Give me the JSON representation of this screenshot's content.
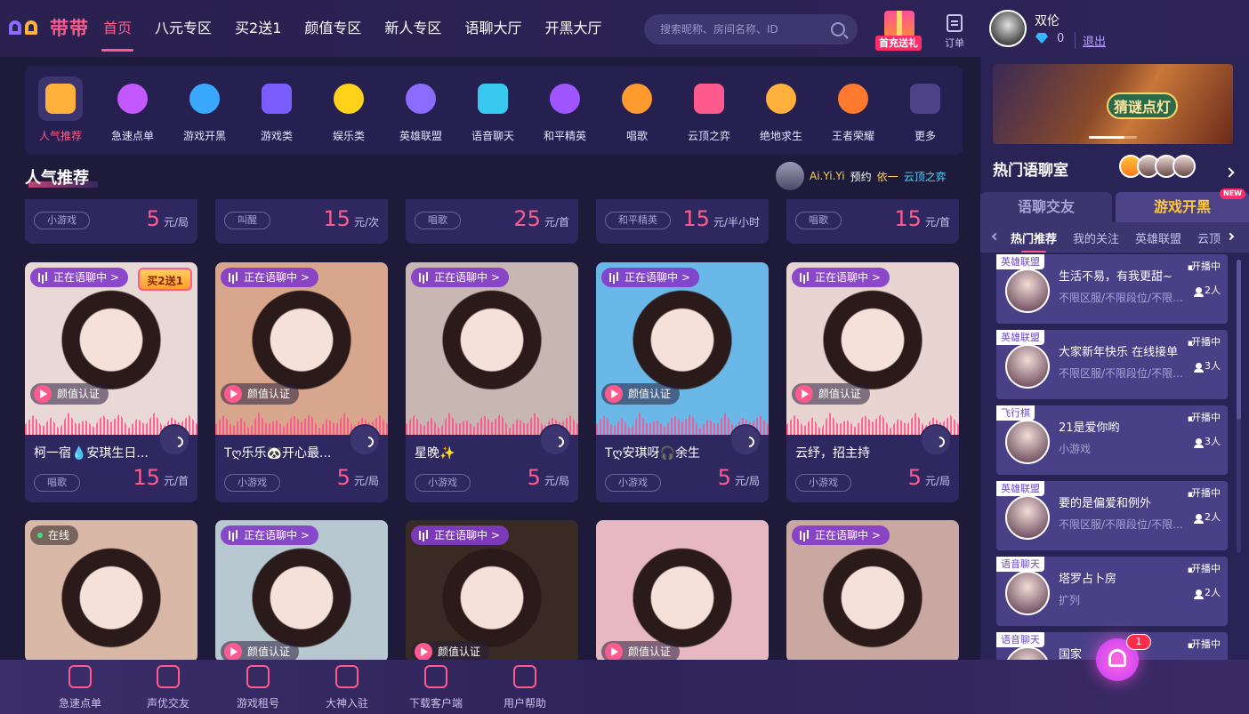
{
  "brand": {
    "name": "带带"
  },
  "nav": {
    "items": [
      {
        "label": "首页",
        "active": true
      },
      {
        "label": "八元专区"
      },
      {
        "label": "买2送1"
      },
      {
        "label": "颜值专区"
      },
      {
        "label": "新人专区"
      },
      {
        "label": "语聊大厅"
      },
      {
        "label": "开黑大厅"
      }
    ]
  },
  "search": {
    "placeholder": "搜索昵称、房间名称、ID"
  },
  "gift": {
    "label": "首充送礼"
  },
  "order": {
    "label": "订单"
  },
  "user": {
    "name": "双伦",
    "diamonds": "0",
    "logout": "退出"
  },
  "categories": [
    {
      "label": "人气推荐",
      "icon": "hexagon-star-icon",
      "color": "#ffb13b",
      "active": true
    },
    {
      "label": "急速点单",
      "icon": "checkbox-icon",
      "color": "#c458ff"
    },
    {
      "label": "游戏开黑",
      "icon": "swords-icon",
      "color": "#3aa8ff"
    },
    {
      "label": "游戏类",
      "icon": "gamepad-icon",
      "color": "#7a5cff"
    },
    {
      "label": "娱乐类",
      "icon": "chick-icon",
      "color": "#ffd21a"
    },
    {
      "label": "英雄联盟",
      "icon": "lol-icon",
      "color": "#8b6cff"
    },
    {
      "label": "语音聊天",
      "icon": "voice-bubble-icon",
      "color": "#38c9f0"
    },
    {
      "label": "和平精英",
      "icon": "pubg-mobile-icon",
      "color": "#a056ff"
    },
    {
      "label": "唱歌",
      "icon": "music-note-icon",
      "color": "#ff9a2e"
    },
    {
      "label": "云顶之弈",
      "icon": "tft-icon",
      "color": "#ff5a8e"
    },
    {
      "label": "绝地求生",
      "icon": "pubg-icon",
      "color": "#ffb13b"
    },
    {
      "label": "王者荣耀",
      "icon": "honor-of-kings-icon",
      "color": "#ff7a2e"
    },
    {
      "label": "更多",
      "icon": "more-dots-icon",
      "color": "#4d4288"
    }
  ],
  "section": {
    "title": "人气推荐"
  },
  "booking": {
    "user": "Ai.Yi.Yi",
    "verb": "预约",
    "target": "依一",
    "game": "云顶之弈"
  },
  "price_strip": [
    {
      "tag": "小游戏",
      "price": "5",
      "unit": "元/局"
    },
    {
      "tag": "叫醒",
      "price": "15",
      "unit": "元/次"
    },
    {
      "tag": "唱歌",
      "price": "25",
      "unit": "元/首"
    },
    {
      "tag": "和平精英",
      "price": "15",
      "unit": "元/半小时"
    },
    {
      "tag": "唱歌",
      "price": "15",
      "unit": "元/首"
    }
  ],
  "cards": [
    {
      "badge": "正在语聊中 >",
      "promo": "买2送1",
      "verify": "颜值认证",
      "name": "柯一宿💧安琪生日...",
      "tag": "唱歌",
      "price": "15",
      "unit": "元/首",
      "bg": "#e8d8d6"
    },
    {
      "badge": "正在语聊中 >",
      "verify": "颜值认证",
      "name": "Tღ乐乐🐼开心最...",
      "tag": "小游戏",
      "price": "5",
      "unit": "元/局",
      "bg": "#d7a68c"
    },
    {
      "badge": "正在语聊中 >",
      "name": "星晚✨",
      "tag": "小游戏",
      "price": "5",
      "unit": "元/局",
      "bg": "#c8b6b2"
    },
    {
      "badge": "正在语聊中 >",
      "verify": "颜值认证",
      "name": "Tღ安琪呀🎧余生",
      "tag": "小游戏",
      "price": "5",
      "unit": "元/局",
      "bg": "#6ab8e8"
    },
    {
      "badge": "正在语聊中 >",
      "verify": "颜值认证",
      "name": "云纾，招主持",
      "tag": "小游戏",
      "price": "5",
      "unit": "元/局",
      "bg": "#e8d4d0"
    }
  ],
  "cards_row2": [
    {
      "online": "在线",
      "bg": "#d9b8a8"
    },
    {
      "badge": "正在语聊中 >",
      "verify": "颜值认证",
      "bg": "#b8c8d0"
    },
    {
      "badge": "正在语聊中 >",
      "verify": "颜值认证",
      "bg": "#3a2a24"
    },
    {
      "verify": "颜值认证",
      "bg": "#e8b8c0"
    },
    {
      "badge": "正在语聊中 >",
      "bg": "#c8a8a0"
    }
  ],
  "sidebar": {
    "banner_text": "猜谜点灯",
    "hot_title": "热门语聊室",
    "tabs": [
      {
        "label": "语聊交友"
      },
      {
        "label": "游戏开黑",
        "new": "NEW"
      }
    ],
    "subtabs": [
      {
        "label": "热门推荐",
        "active": true
      },
      {
        "label": "我的关注"
      },
      {
        "label": "英雄联盟"
      },
      {
        "label": "云顶"
      }
    ],
    "rooms": [
      {
        "cat": "英雄联盟",
        "title": "生活不易，有我更甜~",
        "sub": "不限区服/不限段位/不限...",
        "status": "开播中",
        "count": "2人"
      },
      {
        "cat": "英雄联盟",
        "title": "大家新年快乐 在线接单",
        "sub": "不限区服/不限段位/不限...",
        "status": "开播中",
        "count": "3人"
      },
      {
        "cat": "飞行棋",
        "title": "21是爱你哟",
        "sub": "小游戏",
        "status": "开播中",
        "count": "3人"
      },
      {
        "cat": "英雄联盟",
        "title": "要的是偏爱和例外",
        "sub": "不限区服/不限段位/不限...",
        "status": "开播中",
        "count": "2人"
      },
      {
        "cat": "语音聊天",
        "title": "塔罗占卜房",
        "sub": "扩列",
        "status": "开播中",
        "count": "2人"
      },
      {
        "cat": "语音聊天",
        "title": "国家",
        "sub": "",
        "status": "开播中",
        "count": ""
      }
    ],
    "notification_count": "1"
  },
  "bottom": [
    {
      "label": "急速点单",
      "icon": "clipboard-check-icon"
    },
    {
      "label": "声优交友",
      "icon": "heart-bubble-icon"
    },
    {
      "label": "游戏租号",
      "icon": "id-card-icon"
    },
    {
      "label": "大神入驻",
      "icon": "crown-icon"
    },
    {
      "label": "下载客户端",
      "icon": "download-icon"
    },
    {
      "label": "用户帮助",
      "icon": "help-doc-icon"
    }
  ]
}
